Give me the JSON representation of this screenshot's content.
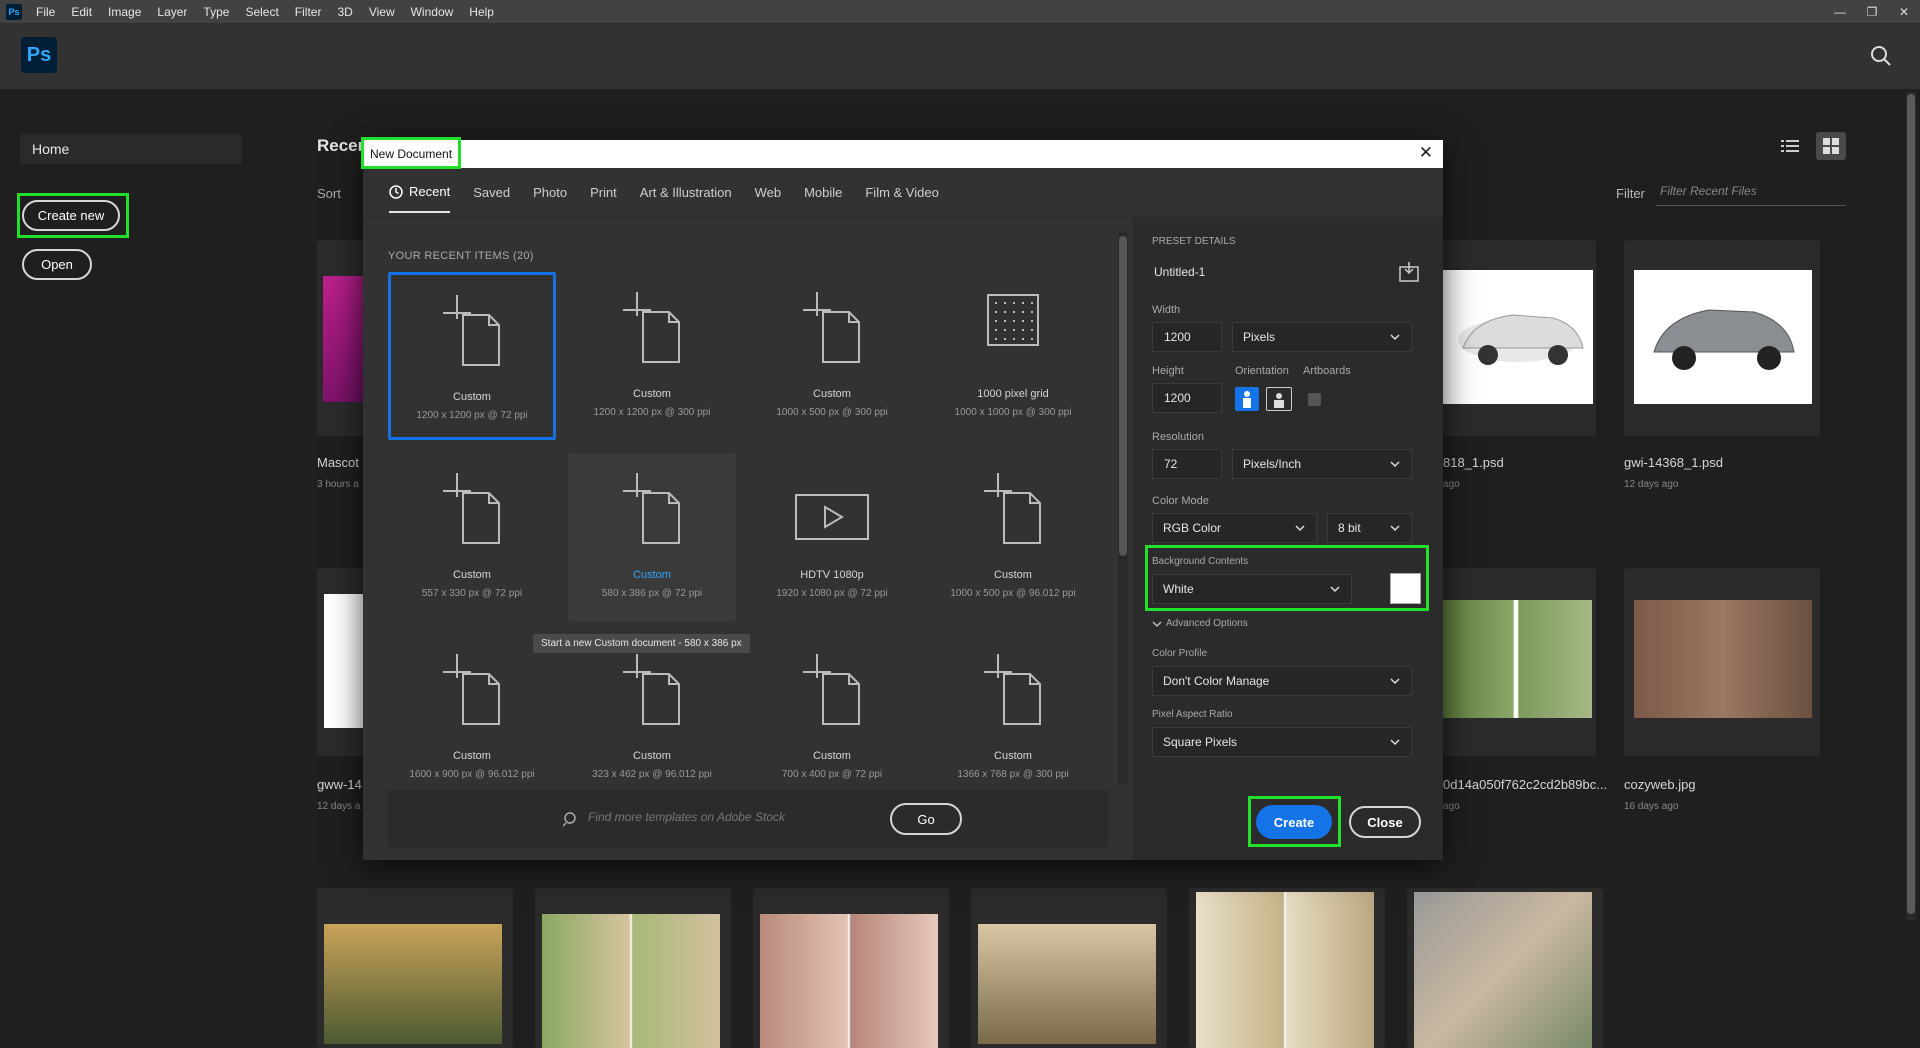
{
  "menubar": {
    "items": [
      "File",
      "Edit",
      "Image",
      "Layer",
      "Type",
      "Select",
      "Filter",
      "3D",
      "View",
      "Window",
      "Help"
    ],
    "logo": "Ps"
  },
  "app": {
    "logo": "Ps"
  },
  "left": {
    "home": "Home",
    "create_new": "Create new",
    "open": "Open"
  },
  "recent": {
    "title": "Recent",
    "sort": "Sort",
    "filter_label": "Filter",
    "filter_placeholder": "Filter Recent Files"
  },
  "files": [
    {
      "name": "Mascot",
      "date": "3 hours a"
    },
    {
      "name": "818_1.psd",
      "date": "ago"
    },
    {
      "name": "gwi-14368_1.psd",
      "date": "12 days ago"
    },
    {
      "name": "gww-14",
      "date": "12 days a"
    },
    {
      "name": "0d14a050f762c2cd2b89bc...",
      "date": "ago"
    },
    {
      "name": "cozyweb.jpg",
      "date": "16 days ago"
    }
  ],
  "dialog": {
    "title": "New Document",
    "close_icon": "close-icon",
    "tabs": [
      "Recent",
      "Saved",
      "Photo",
      "Print",
      "Art & Illustration",
      "Web",
      "Mobile",
      "Film & Video"
    ],
    "section_title": "YOUR RECENT ITEMS  (20)",
    "items": [
      {
        "name": "Custom",
        "size": "1200 x 1200 px @ 72 ppi",
        "icon": "document-icon"
      },
      {
        "name": "Custom",
        "size": "1200 x 1200 px @ 300 ppi",
        "icon": "document-icon"
      },
      {
        "name": "Custom",
        "size": "1000 x 500 px @ 300 ppi",
        "icon": "document-icon"
      },
      {
        "name": "1000 pixel grid",
        "size": "1000 x 1000 px @ 300 ppi",
        "icon": "grid-icon"
      },
      {
        "name": "Custom",
        "size": "557 x 330 px @ 72 ppi",
        "icon": "document-icon"
      },
      {
        "name": "Custom",
        "size": "580 x 386 px @ 72 ppi",
        "icon": "document-icon"
      },
      {
        "name": "HDTV 1080p",
        "size": "1920 x 1080 px @ 72 ppi",
        "icon": "video-icon"
      },
      {
        "name": "Custom",
        "size": "1000 x 500 px @ 96.012 ppi",
        "icon": "document-icon"
      },
      {
        "name": "Custom",
        "size": "1600 x 900 px @ 96.012 ppi",
        "icon": "document-icon"
      },
      {
        "name": "Custom",
        "size": "323 x 462 px @ 96.012 ppi",
        "icon": "document-icon"
      },
      {
        "name": "Custom",
        "size": "700 x 400 px @ 72 ppi",
        "icon": "document-icon"
      },
      {
        "name": "Custom",
        "size": "1366 x 768 px @ 300 ppi",
        "icon": "document-icon"
      }
    ],
    "tooltip": "Start a new Custom document - 580 x 386 px",
    "stock_placeholder": "Find more templates on Adobe Stock",
    "go": "Go",
    "preset": {
      "title": "PRESET DETAILS",
      "name": "Untitled-1",
      "width_label": "Width",
      "width": "1200",
      "width_unit": "Pixels",
      "height_label": "Height",
      "height": "1200",
      "orientation_label": "Orientation",
      "artboards_label": "Artboards",
      "resolution_label": "Resolution",
      "resolution": "72",
      "resolution_unit": "Pixels/Inch",
      "color_mode_label": "Color Mode",
      "color_mode": "RGB Color",
      "bit_depth": "8 bit",
      "background_label": "Background Contents",
      "background": "White",
      "advanced": "Advanced Options",
      "color_profile_label": "Color Profile",
      "color_profile": "Don't Color Manage",
      "pixel_aspect_label": "Pixel Aspect Ratio",
      "pixel_aspect": "Square Pixels"
    },
    "create": "Create",
    "close": "Close"
  },
  "colors": {
    "accent": "#1473e6",
    "highlight": "#22e02a"
  }
}
